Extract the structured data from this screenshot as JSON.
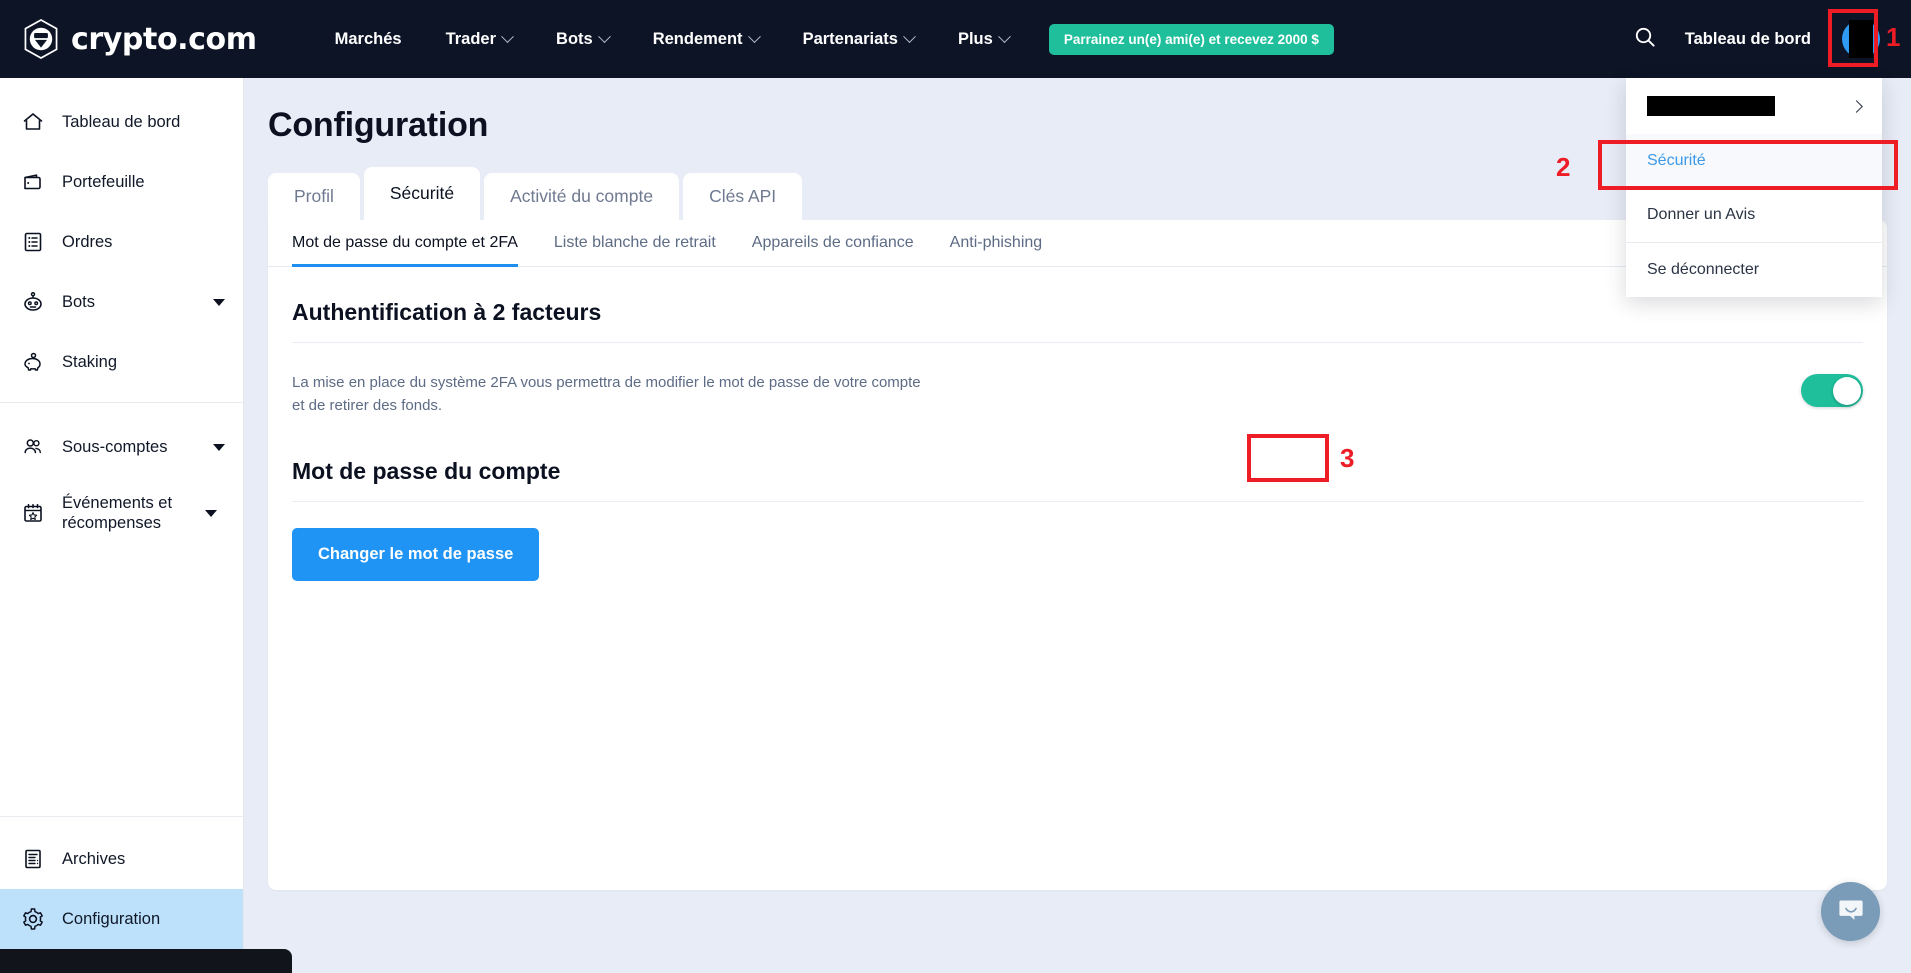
{
  "header": {
    "brand": "crypto.com",
    "brand_logo_icon": "crypto-com-logo-icon",
    "nav": [
      {
        "label": "Marchés",
        "has_caret": false
      },
      {
        "label": "Trader",
        "has_caret": true
      },
      {
        "label": "Bots",
        "has_caret": true
      },
      {
        "label": "Rendement",
        "has_caret": true
      },
      {
        "label": "Partenariats",
        "has_caret": true
      },
      {
        "label": "Plus",
        "has_caret": true
      }
    ],
    "referral_label": "Parrainez un(e) ami(e) et recevez 2000 $",
    "search_icon": "search-icon",
    "dashboard_label": "Tableau de bord",
    "avatar_icon": "user-avatar"
  },
  "sidebar": {
    "top_items": [
      {
        "label": "Tableau de bord",
        "icon": "home-icon",
        "caret": false,
        "active": false
      },
      {
        "label": "Portefeuille",
        "icon": "wallet-icon",
        "caret": false,
        "active": false
      },
      {
        "label": "Ordres",
        "icon": "orders-list-icon",
        "caret": false,
        "active": false
      },
      {
        "label": "Bots",
        "icon": "robot-icon",
        "caret": true,
        "active": false
      },
      {
        "label": "Staking",
        "icon": "piggy-bank-icon",
        "caret": false,
        "active": false
      }
    ],
    "mid_items": [
      {
        "label": "Sous-comptes",
        "icon": "users-icon",
        "caret": true,
        "active": false
      },
      {
        "label": "Événements et récompenses",
        "icon": "calendar-star-icon",
        "caret": true,
        "active": false
      }
    ],
    "bottom_items": [
      {
        "label": "Archives",
        "icon": "archive-document-icon",
        "caret": false,
        "active": false
      },
      {
        "label": "Configuration",
        "icon": "gear-icon",
        "caret": false,
        "active": true
      }
    ]
  },
  "main": {
    "page_title": "Configuration",
    "tabs": [
      {
        "label": "Profil",
        "active": false
      },
      {
        "label": "Sécurité",
        "active": true
      },
      {
        "label": "Activité du compte",
        "active": false
      },
      {
        "label": "Clés API",
        "active": false
      }
    ],
    "subtabs": [
      {
        "label": "Mot de passe du compte et 2FA",
        "active": true
      },
      {
        "label": "Liste blanche de retrait",
        "active": false
      },
      {
        "label": "Appareils de confiance",
        "active": false
      },
      {
        "label": "Anti-phishing",
        "active": false
      }
    ],
    "twofa": {
      "heading": "Authentification à 2 facteurs",
      "description": "La mise en place du système 2FA vous permettra de modifier le mot de passe de votre compte et de retirer des fonds.",
      "toggle_state": "on"
    },
    "password": {
      "heading": "Mot de passe du compte",
      "button_label": "Changer le mot de passe"
    }
  },
  "dropdown": {
    "account_name": "",
    "account_chevron_icon": "chevron-right-icon",
    "items": [
      {
        "label": "Sécurité",
        "highlight": true
      },
      {
        "label": "Donner un Avis",
        "highlight": false
      },
      {
        "label": "Se déconnecter",
        "highlight": false
      }
    ]
  },
  "annotations": [
    {
      "number": "1",
      "target": "avatar"
    },
    {
      "number": "2",
      "target": "dropdown-securite"
    },
    {
      "number": "3",
      "target": "twofa-toggle"
    }
  ],
  "chat": {
    "icon": "chat-bubble-icon"
  },
  "colors": {
    "header_bg": "#0d1426",
    "accent_teal": "#1fbf9b",
    "accent_blue": "#1f94f5",
    "annotation_red": "#ee1c25",
    "sidebar_active": "#bde1fb",
    "main_bg": "#e8ecf6",
    "link_blue": "#3d9ae8"
  }
}
